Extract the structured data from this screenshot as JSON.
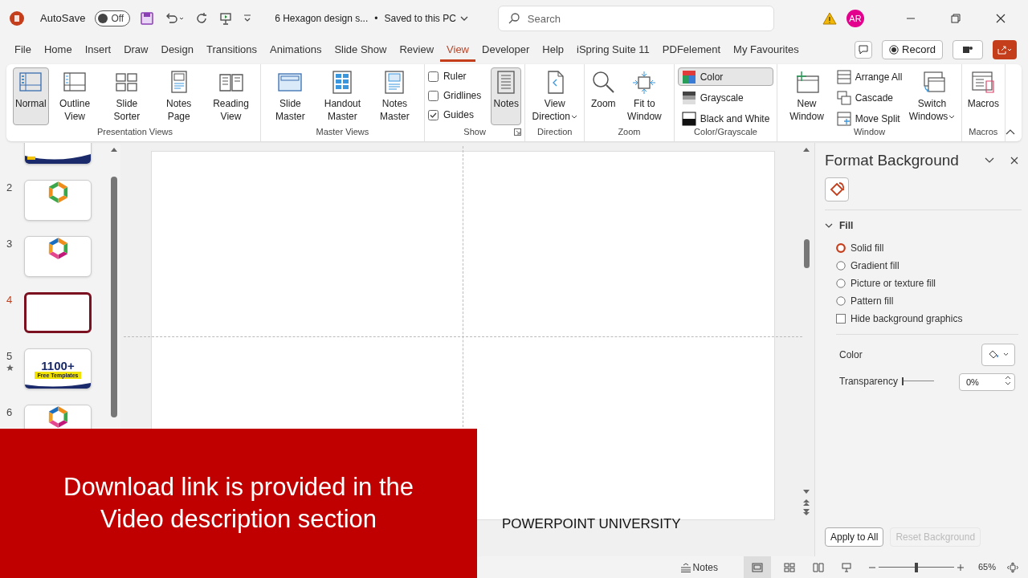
{
  "title_bar": {
    "autosave_label": "AutoSave",
    "autosave_on": false,
    "autosave_state": "Off",
    "document_title": "6 Hexagon design s...",
    "separator": "•",
    "save_status": "Saved to this PC",
    "search": {
      "placeholder": "Search"
    },
    "avatar": "AR"
  },
  "tabs": [
    {
      "label": "File",
      "selected": false
    },
    {
      "label": "Home",
      "selected": false
    },
    {
      "label": "Insert",
      "selected": false
    },
    {
      "label": "Draw",
      "selected": false
    },
    {
      "label": "Design",
      "selected": false
    },
    {
      "label": "Transitions",
      "selected": false
    },
    {
      "label": "Animations",
      "selected": false
    },
    {
      "label": "Slide Show",
      "selected": false
    },
    {
      "label": "Review",
      "selected": false
    },
    {
      "label": "View",
      "selected": true
    },
    {
      "label": "Developer",
      "selected": false
    },
    {
      "label": "Help",
      "selected": false
    },
    {
      "label": "iSpring Suite 11",
      "selected": false
    },
    {
      "label": "PDFelement",
      "selected": false
    },
    {
      "label": "My Favourites",
      "selected": false
    }
  ],
  "record_button": "Record",
  "ribbon_groups": [
    {
      "label": "Presentation Views",
      "items": [
        {
          "kind": "large",
          "label": "Normal",
          "selected": true
        },
        {
          "kind": "large",
          "label": "Outline View",
          "selected": false
        },
        {
          "kind": "large",
          "label": "Slide Sorter",
          "selected": false
        },
        {
          "kind": "large",
          "label": "Notes Page",
          "selected": false
        },
        {
          "kind": "large",
          "label": "Reading View",
          "selected": false
        }
      ]
    },
    {
      "label": "Master Views",
      "items": [
        {
          "kind": "large",
          "label": "Slide Master",
          "selected": false
        },
        {
          "kind": "large",
          "label": "Handout Master",
          "selected": false
        },
        {
          "kind": "large",
          "label": "Notes Master",
          "selected": false
        }
      ]
    },
    {
      "label": "Show",
      "launcher": true,
      "items": [
        {
          "kind": "checks",
          "checks": [
            {
              "label": "Ruler",
              "checked": false
            },
            {
              "label": "Gridlines",
              "checked": false
            },
            {
              "label": "Guides",
              "checked": true
            }
          ]
        },
        {
          "kind": "large",
          "label": "Notes",
          "selected": true
        }
      ]
    },
    {
      "label": "Direction",
      "items": [
        {
          "kind": "large",
          "label": "View Direction",
          "dropdown": true,
          "selected": false
        }
      ]
    },
    {
      "label": "Zoom",
      "items": [
        {
          "kind": "large",
          "label": "Zoom",
          "selected": false
        },
        {
          "kind": "large",
          "label": "Fit to Window",
          "selected": false
        }
      ]
    },
    {
      "label": "Color/Grayscale",
      "items": [
        {
          "kind": "smalls",
          "buttons": [
            {
              "label": "Color",
              "selected": true
            },
            {
              "label": "Grayscale",
              "selected": false
            },
            {
              "label": "Black and White",
              "selected": false
            }
          ]
        }
      ]
    },
    {
      "label": "Window",
      "items": [
        {
          "kind": "large",
          "label": "New Window",
          "selected": false
        },
        {
          "kind": "smalls",
          "buttons": [
            {
              "label": "Arrange All",
              "selected": false
            },
            {
              "label": "Cascade",
              "selected": false
            },
            {
              "label": "Move Split",
              "selected": false
            }
          ]
        },
        {
          "kind": "large",
          "label": "Switch Windows",
          "dropdown": true,
          "selected": false
        }
      ]
    },
    {
      "label": "Macros",
      "items": [
        {
          "kind": "large",
          "label": "Macros",
          "selected": false
        }
      ]
    }
  ],
  "slides": [
    {
      "kind": "banner",
      "selected": false
    },
    {
      "number": "2",
      "kind": "hexagon",
      "selected": false,
      "animated": false
    },
    {
      "number": "3",
      "kind": "hexagon",
      "selected": false,
      "animated": false
    },
    {
      "number": "4",
      "kind": "blank",
      "selected": true,
      "animated": false
    },
    {
      "number": "5",
      "kind": "promo",
      "selected": false,
      "animated": true,
      "headline": "1100+",
      "tagline": "Free Templates"
    },
    {
      "number": "6",
      "kind": "hexagon",
      "selected": false,
      "animated": false
    }
  ],
  "watermark_text": "POWERPOINT UNIVERSITY",
  "banner": {
    "text": "Download link is provided in the Video description section"
  },
  "format_pane": {
    "title": "Format Background",
    "section": "Fill",
    "expanded": true,
    "options": [
      {
        "kind": "radio",
        "label": "Solid fill",
        "selected": true
      },
      {
        "kind": "radio",
        "label": "Gradient fill",
        "selected": false
      },
      {
        "kind": "radio",
        "label": "Picture or texture fill",
        "selected": false
      },
      {
        "kind": "radio",
        "label": "Pattern fill",
        "selected": false
      },
      {
        "kind": "checkbox",
        "label": "Hide background graphics",
        "checked": false
      }
    ],
    "color_label": "Color",
    "transparency_label": "Transparency",
    "transparency": {
      "level": 0,
      "value": "0%"
    },
    "buttons": [
      {
        "label": "Apply to All",
        "disabled": false
      },
      {
        "label": "Reset Background",
        "disabled": true
      }
    ]
  },
  "status_bar": {
    "notes": "Notes",
    "zoom": {
      "level": 0.5
    },
    "zoom_value": "65%"
  }
}
